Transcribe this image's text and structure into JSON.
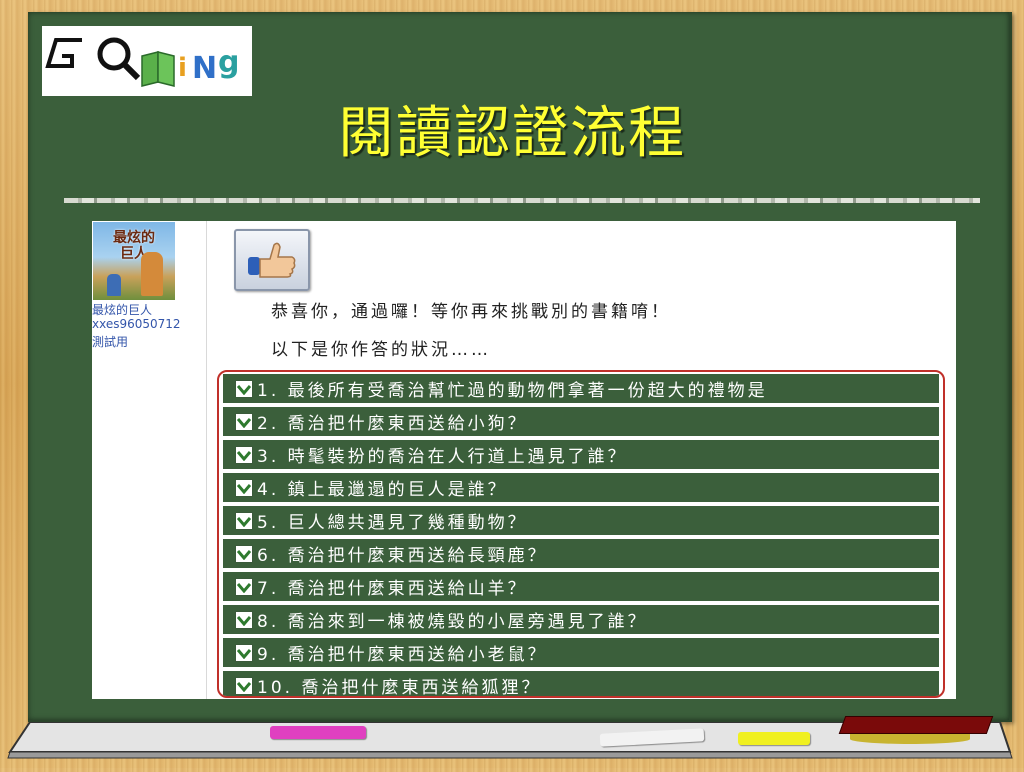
{
  "slide": {
    "title": "閱讀認證流程",
    "logo_text": "GOing"
  },
  "book": {
    "cover_title": "最炫的巨人",
    "name": "最炫的巨人",
    "user_id": "xxes96050712",
    "note": "測試用"
  },
  "result": {
    "congrats": "恭喜你，通過囉！等你再來挑戰別的書籍唷！",
    "status_intro": "以下是你作答的狀況……"
  },
  "questions": [
    {
      "label": "1. 最後所有受喬治幫忙過的動物們拿著一份超大的禮物是"
    },
    {
      "label": "2. 喬治把什麼東西送給小狗？"
    },
    {
      "label": "3. 時髦裝扮的喬治在人行道上遇見了誰？"
    },
    {
      "label": "4. 鎮上最邋遢的巨人是誰？"
    },
    {
      "label": "5. 巨人總共遇見了幾種動物？"
    },
    {
      "label": "6. 喬治把什麼東西送給長頸鹿？"
    },
    {
      "label": "7. 喬治把什麼東西送給山羊？"
    },
    {
      "label": "8. 喬治來到一棟被燒毀的小屋旁遇見了誰？"
    },
    {
      "label": "9. 喬治把什麼東西送給小老鼠？"
    },
    {
      "label": "10. 喬治把什麼東西送給狐狸？"
    }
  ],
  "colors": {
    "board": "#3b5f3b",
    "title": "#ffff33",
    "frame": "#c0302a",
    "chalk_pink": "#e040c0",
    "chalk_white": "#f2f2f2",
    "chalk_yellow": "#f0f020",
    "eraser": "#7a0a0a"
  }
}
